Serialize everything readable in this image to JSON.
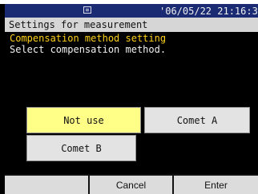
{
  "status_bar": {
    "icon": "monitor-icon",
    "datetime": "'06/05/22 21:16:3"
  },
  "header": {
    "title": "Settings for measurement"
  },
  "main": {
    "heading": "Compensation method setting",
    "instruction": "Select compensation method."
  },
  "options": {
    "not_use": "Not use",
    "comet_a": "Comet  A",
    "comet_b": "Comet  B",
    "selected": "Not use"
  },
  "softkeys": {
    "f1": "",
    "cancel": "Cancel",
    "enter": "Enter"
  },
  "colors": {
    "title_bar": "#1a2b73",
    "heading": "#ffd21a",
    "selected_option": "#ffff88",
    "option": "#e3e3e3"
  }
}
